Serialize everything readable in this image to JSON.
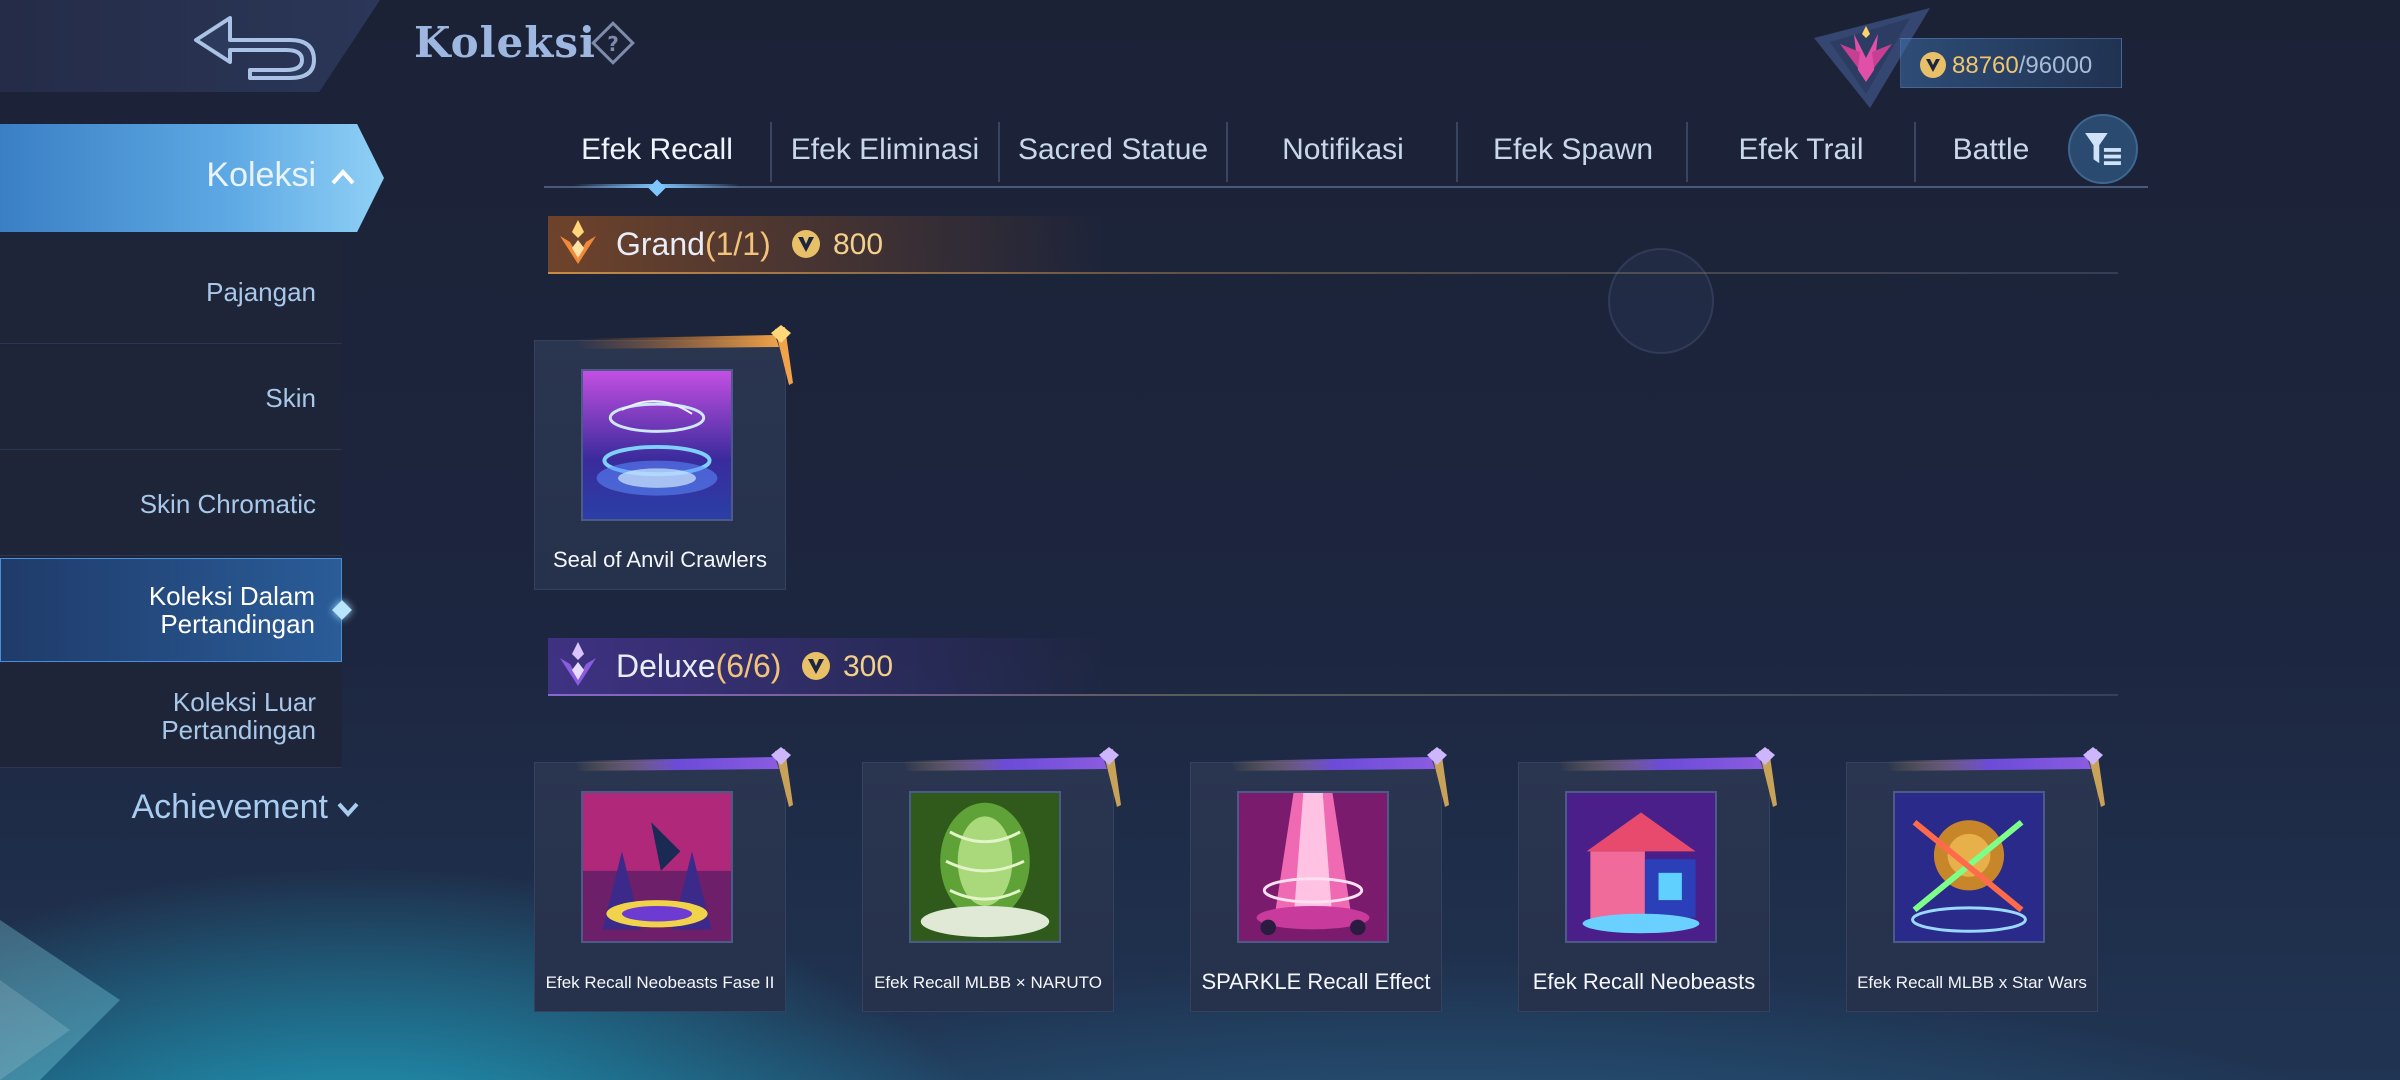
{
  "header": {
    "title": "Koleksi",
    "currency": {
      "current": "88760",
      "separator": "/",
      "total": "96000"
    }
  },
  "sidebar": {
    "active": {
      "label": "Koleksi"
    },
    "items": [
      {
        "label": "Pajangan",
        "selected": false
      },
      {
        "label": "Skin",
        "selected": false
      },
      {
        "label": "Skin Chromatic",
        "selected": false
      },
      {
        "label": "Koleksi Dalam Pertandingan",
        "selected": true
      },
      {
        "label": "Koleksi Luar Pertandingan",
        "selected": false
      }
    ],
    "achievement": "Achievement"
  },
  "tabs": [
    {
      "label": "Efek Recall",
      "active": true
    },
    {
      "label": "Efek Eliminasi",
      "active": false
    },
    {
      "label": "Sacred Statue",
      "active": false
    },
    {
      "label": "Notifikasi",
      "active": false
    },
    {
      "label": "Efek Spawn",
      "active": false
    },
    {
      "label": "Efek Trail",
      "active": false
    },
    {
      "label": "Battle",
      "active": false
    }
  ],
  "sections": {
    "grand": {
      "label": "Grand",
      "count": "(1/1)",
      "price": "800",
      "items": [
        {
          "name": "Seal of Anvil Crawlers"
        }
      ]
    },
    "deluxe": {
      "label": "Deluxe",
      "count": "(6/6)",
      "price": "300",
      "items": [
        {
          "name": "Efek Recall Neobeasts Fase II"
        },
        {
          "name": "Efek Recall MLBB × NARUTO"
        },
        {
          "name": "SPARKLE Recall Effect"
        },
        {
          "name": "Efek Recall Neobeasts"
        },
        {
          "name": "Efek Recall MLBB x Star Wars"
        }
      ]
    }
  },
  "colors": {
    "accent_blue": "#5ea9e4",
    "gold": "#f2c37a",
    "grand_orange": "#e89a3c",
    "deluxe_purple": "#8a5ce0"
  }
}
